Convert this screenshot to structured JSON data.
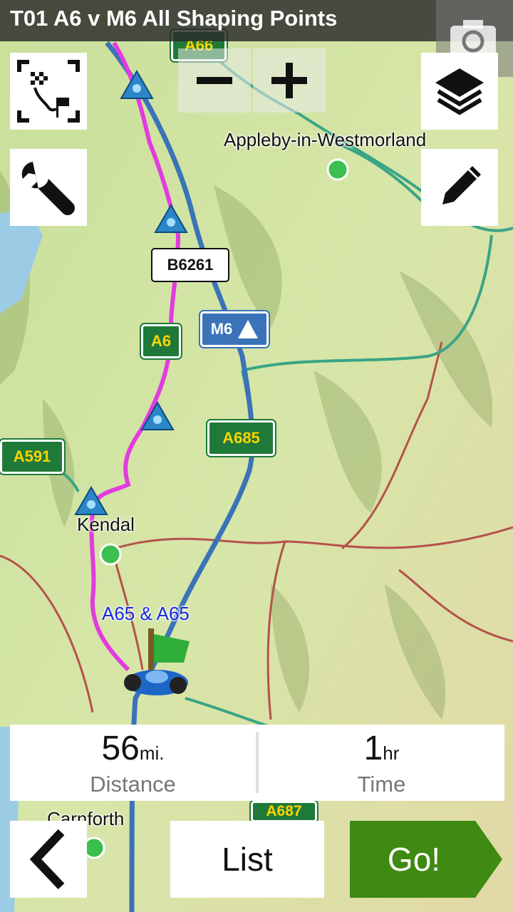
{
  "title": "T01 A6 v M6 All Shaping Points",
  "map": {
    "places": {
      "appleby": "Appleby-in-Westmorland",
      "kendal": "Kendal",
      "carnforth": "Carnforth"
    },
    "road_labels": {
      "a66": "A66",
      "b6261": "B6261",
      "a6": "A6",
      "m6": "M6",
      "a685": "A685",
      "a591": "A591",
      "a687": "A687"
    },
    "route_label": "A65 & A65",
    "colors": {
      "route": "#e33be0",
      "motorway": "#3a73b8",
      "a_road": "#3aa486",
      "b_road": "#b5514c",
      "water": "#9ccbe6",
      "land": "#cfe3a0",
      "go_button": "#3f8a12"
    }
  },
  "controls": {
    "zoom_out_icon": "minus-icon",
    "zoom_in_icon": "plus-icon",
    "fit_route_icon": "route-overview-icon",
    "tools_icon": "wrench-icon",
    "layers_icon": "layers-icon",
    "edit_icon": "pencil-icon",
    "camera_icon": "camera-icon"
  },
  "summary": {
    "distance_value": "56",
    "distance_unit": "mi.",
    "distance_label": "Distance",
    "time_value": "1",
    "time_unit": "hr",
    "time_label": "Time"
  },
  "buttons": {
    "back_icon": "chevron-left-icon",
    "list": "List",
    "go": "Go!"
  }
}
